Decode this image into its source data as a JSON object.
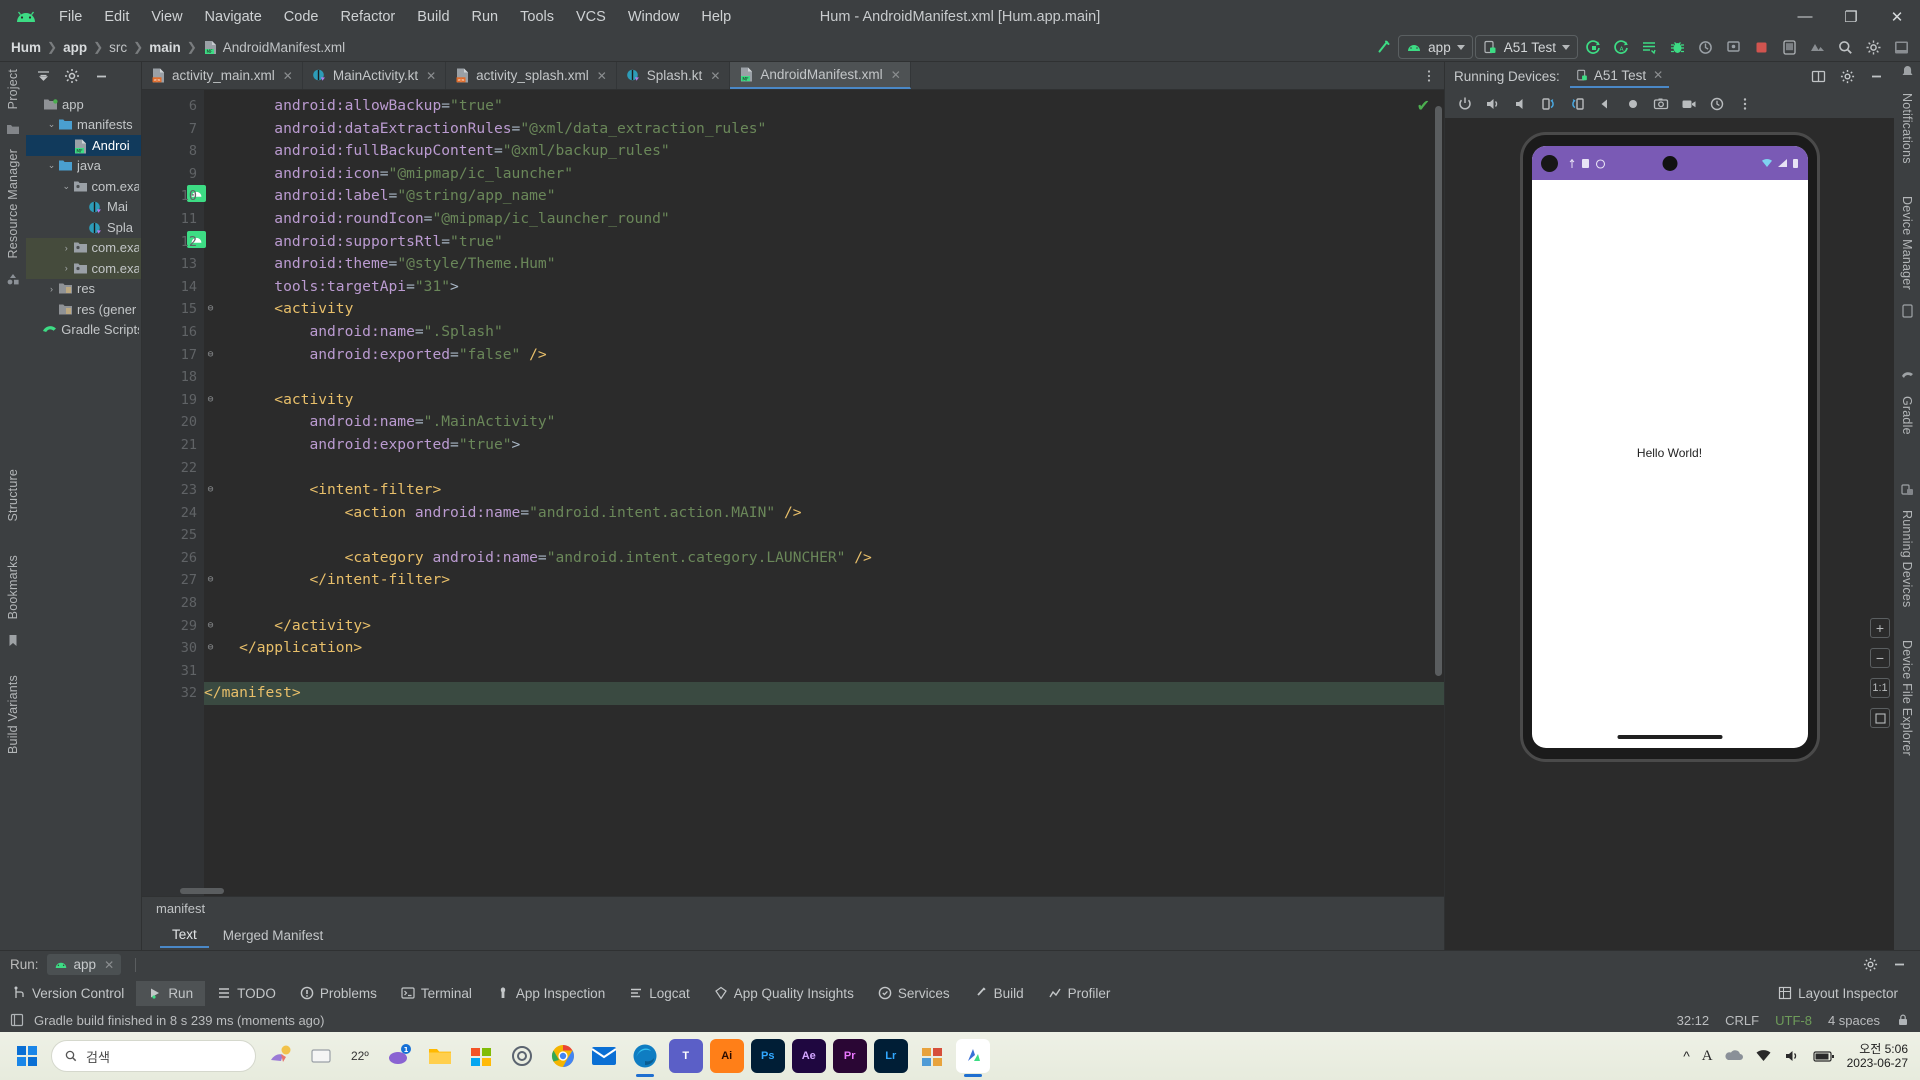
{
  "window": {
    "title": "Hum - AndroidManifest.xml [Hum.app.main]",
    "minimize": "—",
    "maximize": "❐",
    "close": "✕"
  },
  "menu": [
    "File",
    "Edit",
    "View",
    "Navigate",
    "Code",
    "Refactor",
    "Build",
    "Run",
    "Tools",
    "VCS",
    "Window",
    "Help"
  ],
  "breadcrumb": [
    "Hum",
    "app",
    "src",
    "main",
    "AndroidManifest.xml"
  ],
  "toolbar": {
    "module_chip": "app",
    "device_chip": "A51 Test",
    "icons": [
      "hammer-icon",
      "run-icon",
      "debug-run-icon",
      "apply-changes-icon",
      "debug-icon",
      "profile-icon",
      "attach-icon",
      "stop-icon",
      "device-manager-icon",
      "sdk-icon",
      "search-icon",
      "settings-icon",
      "avd-icon"
    ]
  },
  "project_panel": {
    "header_icons": [
      "collapse-icon",
      "settings-icon",
      "hide-icon"
    ],
    "items": [
      {
        "label": "app",
        "depth": 0,
        "arrow": "",
        "icon": "module-folder",
        "state": "normal"
      },
      {
        "label": "manifests",
        "depth": 1,
        "arrow": "⌄",
        "icon": "folder",
        "state": "normal"
      },
      {
        "label": "Androi",
        "depth": 2,
        "arrow": "",
        "icon": "manifest-file",
        "state": "selected"
      },
      {
        "label": "java",
        "depth": 1,
        "arrow": "⌄",
        "icon": "folder",
        "state": "normal"
      },
      {
        "label": "com.exa",
        "depth": 2,
        "arrow": "⌄",
        "icon": "package",
        "state": "normal"
      },
      {
        "label": "Mai",
        "depth": 3,
        "arrow": "",
        "icon": "kotlin-class",
        "state": "normal"
      },
      {
        "label": "Spla",
        "depth": 3,
        "arrow": "",
        "icon": "kotlin-class",
        "state": "normal"
      },
      {
        "label": "com.exa",
        "depth": 2,
        "arrow": "›",
        "icon": "package",
        "state": "group"
      },
      {
        "label": "com.exa",
        "depth": 2,
        "arrow": "›",
        "icon": "package",
        "state": "group"
      },
      {
        "label": "res",
        "depth": 1,
        "arrow": "›",
        "icon": "res-folder",
        "state": "normal"
      },
      {
        "label": "res (gener",
        "depth": 1,
        "arrow": "",
        "icon": "res-folder",
        "state": "normal"
      },
      {
        "label": "Gradle Scripts",
        "depth": 0,
        "arrow": "",
        "icon": "gradle",
        "state": "normal"
      }
    ]
  },
  "editor": {
    "tabs": [
      {
        "label": "activity_main.xml",
        "icon": "layout-xml-icon",
        "active": false
      },
      {
        "label": "MainActivity.kt",
        "icon": "kotlin-icon",
        "active": false
      },
      {
        "label": "activity_splash.xml",
        "icon": "layout-xml-icon",
        "active": false
      },
      {
        "label": "Splash.kt",
        "icon": "kotlin-icon",
        "active": false
      },
      {
        "label": "AndroidManifest.xml",
        "icon": "manifest-icon",
        "active": true
      }
    ],
    "first_line_number": 6,
    "lines": [
      {
        "n": 6,
        "indent": 8,
        "tokens": [
          [
            "attr",
            "android:allowBackup"
          ],
          [
            "eq",
            "="
          ],
          [
            "str",
            "\"true\""
          ]
        ]
      },
      {
        "n": 7,
        "indent": 8,
        "tokens": [
          [
            "attr",
            "android:dataExtractionRules"
          ],
          [
            "eq",
            "="
          ],
          [
            "str",
            "\"@xml/data_extraction_rules\""
          ]
        ]
      },
      {
        "n": 8,
        "indent": 8,
        "tokens": [
          [
            "attr",
            "android:fullBackupContent"
          ],
          [
            "eq",
            "="
          ],
          [
            "str",
            "\"@xml/backup_rules\""
          ]
        ]
      },
      {
        "n": 9,
        "indent": 8,
        "tokens": [
          [
            "attr",
            "android:icon"
          ],
          [
            "eq",
            "="
          ],
          [
            "str",
            "\"@mipmap/ic_launcher\""
          ]
        ],
        "badge": true
      },
      {
        "n": 10,
        "indent": 8,
        "tokens": [
          [
            "attr",
            "android:label"
          ],
          [
            "eq",
            "="
          ],
          [
            "str",
            "\"@string/app_name\""
          ]
        ]
      },
      {
        "n": 11,
        "indent": 8,
        "tokens": [
          [
            "attr",
            "android:roundIcon"
          ],
          [
            "eq",
            "="
          ],
          [
            "str",
            "\"@mipmap/ic_launcher_round\""
          ]
        ],
        "badge": true
      },
      {
        "n": 12,
        "indent": 8,
        "tokens": [
          [
            "attr",
            "android:supportsRtl"
          ],
          [
            "eq",
            "="
          ],
          [
            "str",
            "\"true\""
          ]
        ]
      },
      {
        "n": 13,
        "indent": 8,
        "tokens": [
          [
            "attr",
            "android:theme"
          ],
          [
            "eq",
            "="
          ],
          [
            "str",
            "\"@style/Theme.Hum\""
          ]
        ]
      },
      {
        "n": 14,
        "indent": 8,
        "tokens": [
          [
            "attr",
            "tools:targetApi"
          ],
          [
            "eq",
            "="
          ],
          [
            "str",
            "\"31\""
          ],
          [
            "eq",
            ">"
          ]
        ]
      },
      {
        "n": 15,
        "indent": 8,
        "tokens": [
          [
            "tagc",
            "<activity"
          ]
        ],
        "fold": true
      },
      {
        "n": 16,
        "indent": 12,
        "tokens": [
          [
            "attr",
            "android:name"
          ],
          [
            "eq",
            "="
          ],
          [
            "str",
            "\".Splash\""
          ]
        ]
      },
      {
        "n": 17,
        "indent": 12,
        "tokens": [
          [
            "attr",
            "android:exported"
          ],
          [
            "eq",
            "="
          ],
          [
            "str",
            "\"false\""
          ],
          [
            "eq",
            " "
          ],
          [
            "tagc",
            "/>"
          ]
        ],
        "fold": true
      },
      {
        "n": 18,
        "indent": 0,
        "tokens": []
      },
      {
        "n": 19,
        "indent": 8,
        "tokens": [
          [
            "tagc",
            "<activity"
          ]
        ],
        "fold": true
      },
      {
        "n": 20,
        "indent": 12,
        "tokens": [
          [
            "attr",
            "android:name"
          ],
          [
            "eq",
            "="
          ],
          [
            "str",
            "\".MainActivity\""
          ]
        ]
      },
      {
        "n": 21,
        "indent": 12,
        "tokens": [
          [
            "attr",
            "android:exported"
          ],
          [
            "eq",
            "="
          ],
          [
            "str",
            "\"true\""
          ],
          [
            "eq",
            ">"
          ]
        ]
      },
      {
        "n": 22,
        "indent": 0,
        "tokens": []
      },
      {
        "n": 23,
        "indent": 12,
        "tokens": [
          [
            "tagc",
            "<intent-filter>"
          ]
        ],
        "fold": true
      },
      {
        "n": 24,
        "indent": 16,
        "tokens": [
          [
            "tagc",
            "<action "
          ],
          [
            "attr",
            "android:name"
          ],
          [
            "eq",
            "="
          ],
          [
            "str",
            "\"android.intent.action.MAIN\""
          ],
          [
            "eq",
            " "
          ],
          [
            "tagc",
            "/>"
          ]
        ]
      },
      {
        "n": 25,
        "indent": 0,
        "tokens": []
      },
      {
        "n": 26,
        "indent": 16,
        "tokens": [
          [
            "tagc",
            "<category "
          ],
          [
            "attr",
            "android:name"
          ],
          [
            "eq",
            "="
          ],
          [
            "str",
            "\"android.intent.category.LAUNCHER\""
          ],
          [
            "eq",
            " "
          ],
          [
            "tagc",
            "/>"
          ]
        ]
      },
      {
        "n": 27,
        "indent": 12,
        "tokens": [
          [
            "tagc",
            "</intent-filter>"
          ]
        ],
        "fold": true
      },
      {
        "n": 28,
        "indent": 0,
        "tokens": []
      },
      {
        "n": 29,
        "indent": 8,
        "tokens": [
          [
            "tagc",
            "</activity>"
          ]
        ],
        "fold": true
      },
      {
        "n": 30,
        "indent": 4,
        "tokens": [
          [
            "tagc",
            "</application>"
          ]
        ],
        "fold": true
      },
      {
        "n": 31,
        "indent": 0,
        "tokens": []
      },
      {
        "n": 32,
        "indent": 0,
        "tokens": [
          [
            "tagc",
            "</manifest>"
          ]
        ],
        "fold": true,
        "highlight": true
      }
    ],
    "footer_breadcrumb": "manifest",
    "subtabs": [
      {
        "label": "Text",
        "active": true
      },
      {
        "label": "Merged Manifest",
        "active": false
      }
    ],
    "status_ok_icon": "checkmark-icon"
  },
  "running_devices": {
    "title": "Running Devices:",
    "tab": "A51 Test",
    "tab_close": "✕",
    "header_actions": [
      "split-icon",
      "settings-icon",
      "minimize-icon"
    ],
    "tool_icons": [
      "power-icon",
      "volume-up-icon",
      "volume-down-icon",
      "rotate-left-icon",
      "rotate-right-icon",
      "back-icon",
      "home-icon",
      "screenshot-icon",
      "record-icon",
      "history-icon",
      "more-icon"
    ],
    "device_screen": {
      "app_text": "Hello World!",
      "status_icons": [
        "wifi-icon",
        "signal-icon",
        "battery-icon"
      ]
    },
    "zoom_controls": [
      "zoom-in-icon",
      "zoom-out-icon",
      "zoom-actual-icon",
      "zoom-fit-icon"
    ],
    "zoom_actual_label": "1:1"
  },
  "run_panel": {
    "label": "Run:",
    "tab": "app",
    "tab_close": "✕",
    "actions": [
      "settings-icon",
      "minimize-icon"
    ]
  },
  "tool_windows": [
    {
      "label": "Version Control",
      "icon": "branch-icon",
      "active": false
    },
    {
      "label": "Run",
      "icon": "run-icon",
      "active": true
    },
    {
      "label": "TODO",
      "icon": "todo-icon",
      "active": false
    },
    {
      "label": "Problems",
      "icon": "problems-icon",
      "active": false
    },
    {
      "label": "Terminal",
      "icon": "terminal-icon",
      "active": false
    },
    {
      "label": "App Inspection",
      "icon": "inspection-icon",
      "active": false
    },
    {
      "label": "Logcat",
      "icon": "logcat-icon",
      "active": false
    },
    {
      "label": "App Quality Insights",
      "icon": "insights-icon",
      "active": false
    },
    {
      "label": "Services",
      "icon": "services-icon",
      "active": false
    },
    {
      "label": "Build",
      "icon": "build-icon",
      "active": false
    },
    {
      "label": "Profiler",
      "icon": "profiler-icon",
      "active": false
    }
  ],
  "tool_windows_right": {
    "label": "Layout Inspector",
    "icon": "layout-inspector-icon"
  },
  "status_bar": {
    "message": "Gradle build finished in 8 s 239 ms (moments ago)",
    "caret": "32:12",
    "line_sep": "CRLF",
    "encoding": "UTF-8",
    "indent": "4 spaces"
  },
  "right_rail": [
    "Notifications",
    "Device Manager",
    "Gradle",
    "Running Devices",
    "Device File Explorer"
  ],
  "left_rail": [
    "Project",
    "Resource Manager",
    "Structure",
    "Bookmarks",
    "Build Variants"
  ],
  "taskbar": {
    "search_placeholder": "검색",
    "weather_temp": "22º",
    "clock_time": "오전 5:06",
    "clock_date": "2023-06-27",
    "apps": [
      {
        "name": "start-icon",
        "color": "#0a6fd4"
      },
      {
        "name": "search-box",
        "color": "#ffffff"
      },
      {
        "name": "widgets-icon",
        "color": "#cfd4e0"
      },
      {
        "name": "task-view-icon",
        "color": "#5b6470"
      },
      {
        "name": "weather-widget",
        "color": "#f2f2f2"
      },
      {
        "name": "copilot-icon",
        "color": "#8a63d2"
      },
      {
        "name": "file-explorer-icon",
        "color": "#ffb900"
      },
      {
        "name": "store-icon",
        "color": "#2b7cd3"
      },
      {
        "name": "settings-icon",
        "color": "#5b6470"
      },
      {
        "name": "chrome-icon",
        "color": "#4285f4"
      },
      {
        "name": "mail-icon",
        "color": "#0a6fd4"
      },
      {
        "name": "edge-icon",
        "color": "#0f7dc2"
      },
      {
        "name": "teams-icon",
        "color": "#5b5fc7"
      },
      {
        "name": "illustrator-icon",
        "color": "#ff7f18"
      },
      {
        "name": "photoshop-icon",
        "color": "#001e36"
      },
      {
        "name": "after-effects-icon",
        "color": "#1f0740"
      },
      {
        "name": "premiere-icon",
        "color": "#2a0634"
      },
      {
        "name": "lightroom-icon",
        "color": "#001e36"
      },
      {
        "name": "office-icon",
        "color": "#e8a33d"
      },
      {
        "name": "android-studio-icon",
        "color": "#ffffff"
      }
    ],
    "tray_icons": [
      "chevron-up-icon",
      "ime-icon",
      "onedrive-icon",
      "wifi-icon",
      "volume-icon",
      "battery-icon"
    ]
  }
}
